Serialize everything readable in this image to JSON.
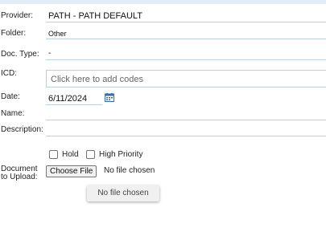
{
  "form": {
    "provider": {
      "label": "Provider:",
      "value": "PATH - PATH DEFAULT"
    },
    "folder": {
      "label": "Folder:",
      "value": "Other"
    },
    "doc_type": {
      "label": "Doc. Type:",
      "value": "-"
    },
    "icd": {
      "label": "ICD:",
      "placeholder": "Click here to add codes"
    },
    "date": {
      "label": "Date:",
      "value": "6/11/2024"
    },
    "name": {
      "label": "Name:",
      "value": ""
    },
    "description": {
      "label": "Description:",
      "value": ""
    },
    "options": {
      "hold_label": "Hold",
      "high_priority_label": "High Priority"
    },
    "upload": {
      "label_line1": "Document",
      "label_line2": "to Upload:",
      "button_label": "Choose File",
      "status": "No file chosen",
      "tooltip": "No file chosen"
    }
  },
  "colors": {
    "field_underline": "#b9cfe0",
    "checkbox_border": "#4a7ab5",
    "top_bar": "#e3ecf5"
  }
}
